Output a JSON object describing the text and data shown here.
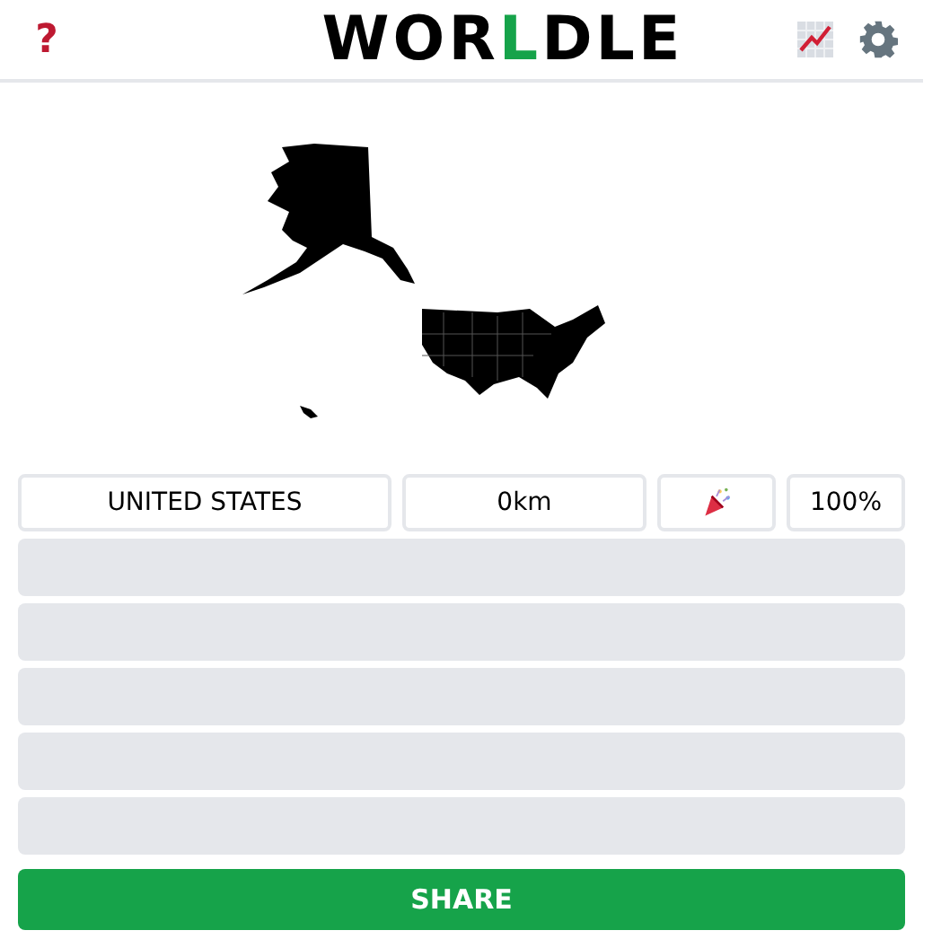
{
  "header": {
    "help_icon": "?",
    "title_parts": [
      {
        "text": "WOR",
        "highlighted": false
      },
      {
        "text": "L",
        "highlighted": true
      },
      {
        "text": "DLE",
        "highlighted": false
      }
    ]
  },
  "guesses": [
    {
      "kind": "filled",
      "country": "UNITED STATES",
      "distance": "0km",
      "arrived": true,
      "proximity": "100%"
    },
    {
      "kind": "empty"
    },
    {
      "kind": "empty"
    },
    {
      "kind": "empty"
    },
    {
      "kind": "empty"
    },
    {
      "kind": "empty"
    }
  ],
  "share_button": "SHARE"
}
